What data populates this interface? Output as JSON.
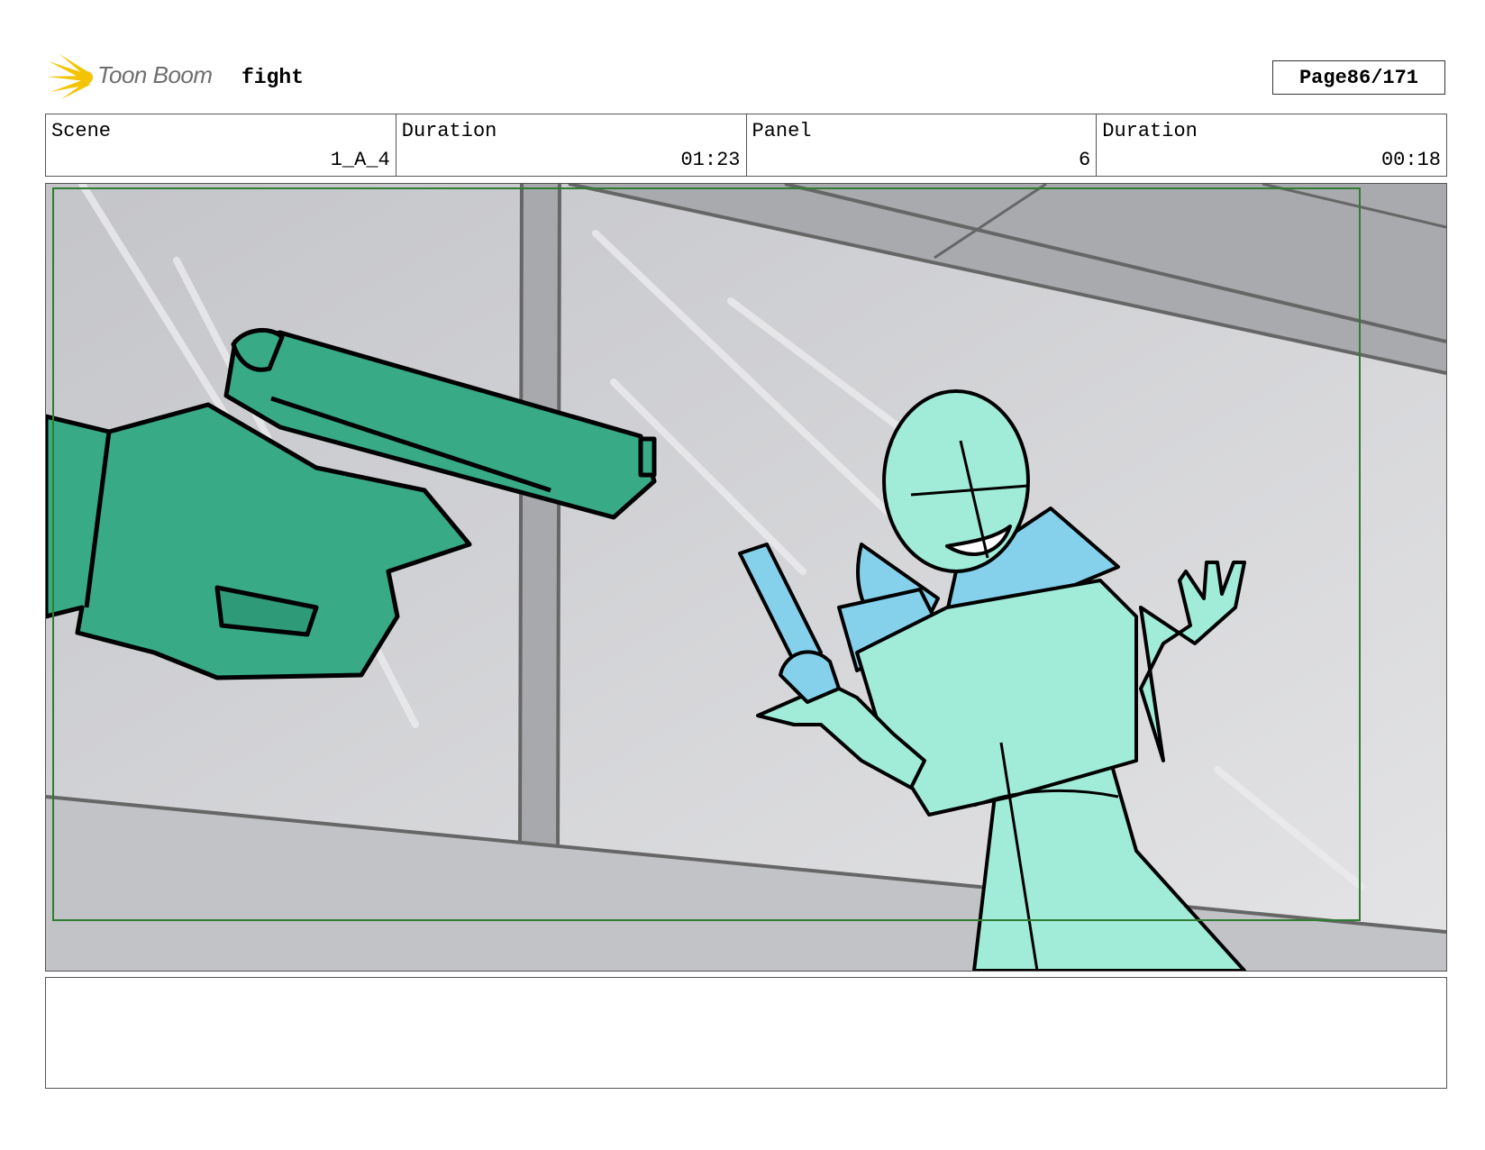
{
  "header": {
    "logo_text": "Toon Boom",
    "project_title": "fight",
    "page_label": "Page",
    "page_number": "86/171"
  },
  "info_table": [
    {
      "label": "Scene",
      "value": "1_A_4"
    },
    {
      "label": "Duration",
      "value": "01:23"
    },
    {
      "label": "Panel",
      "value": "6"
    },
    {
      "label": "Duration",
      "value": "00:18"
    }
  ],
  "panel": {
    "frame_color": "#2e7d32",
    "gun_hand_color": "#38ab86",
    "character_color": "#a0ecd8",
    "scarf_color": "#85d1ec",
    "background_color": "#c8c9cc"
  },
  "notes": {
    "text": ""
  }
}
